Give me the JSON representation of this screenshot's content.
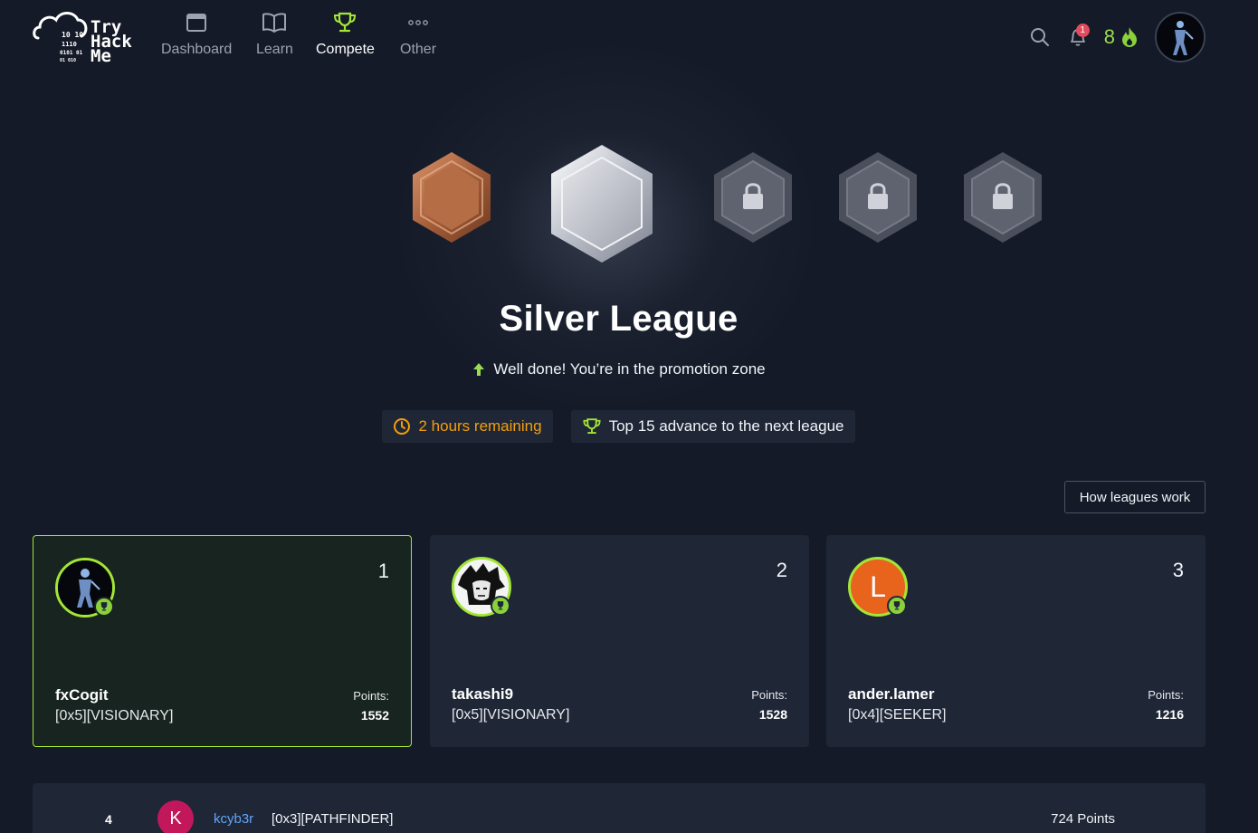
{
  "brand": {
    "logo_text_line1": "Try",
    "logo_text_line2": "Hack",
    "logo_text_line3": "Me",
    "binary_1": "10  10",
    "binary_2": "1110",
    "binary_3": "0101  01",
    "binary_4": "01  010"
  },
  "nav": {
    "items": [
      {
        "label": "Dashboard",
        "icon": "window-icon",
        "active": false
      },
      {
        "label": "Learn",
        "icon": "book-icon",
        "active": false
      },
      {
        "label": "Compete",
        "icon": "trophy-icon",
        "active": true
      },
      {
        "label": "Other",
        "icon": "dots-icon",
        "active": false
      }
    ],
    "notifications_count": "1",
    "streak_count": "8"
  },
  "league": {
    "title": "Silver League",
    "promo_text": "Well done! You’re in the promotion zone",
    "time_remaining": "2 hours remaining",
    "advance_text": "Top 15 advance to the next league",
    "how_button": "How leagues work",
    "tiers": [
      "bronze",
      "silver",
      "locked",
      "locked",
      "locked"
    ]
  },
  "podium": [
    {
      "rank": "1",
      "username": "fxCogit",
      "title": "[0x5][VISIONARY]",
      "points_label": "Points:",
      "points": "1552"
    },
    {
      "rank": "2",
      "username": "takashi9",
      "title": "[0x5][VISIONARY]",
      "points_label": "Points:",
      "points": "1528"
    },
    {
      "rank": "3",
      "username": "ander.lamer",
      "title": "[0x4][SEEKER]",
      "points_label": "Points:",
      "points": "1216",
      "avatar_letter": "L"
    }
  ],
  "leaderboard": [
    {
      "rank": "4",
      "avatar_letter": "K",
      "username": "kcyb3r",
      "title": "[0x3][PATHFINDER]",
      "points": "724 Points"
    }
  ],
  "colors": {
    "accent_green": "#a3e635",
    "warning": "#f59e0b",
    "link": "#60a5fa",
    "bg": "#141a27",
    "card": "#1f2737"
  }
}
